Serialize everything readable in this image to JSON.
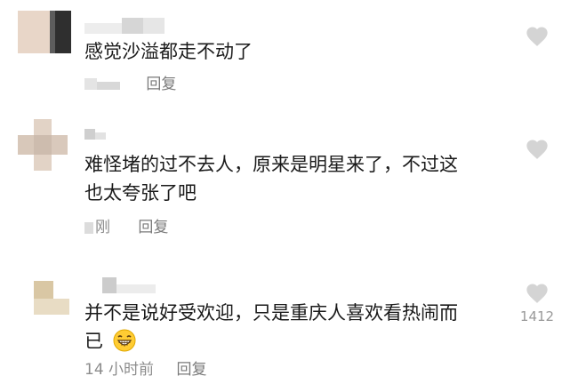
{
  "comments": [
    {
      "text": "感觉沙溢都走不动了",
      "time": "",
      "reply_label": "回复",
      "like_count": ""
    },
    {
      "text": "难怪堵的过不去人，原来是明星来了，不过这\n也太夸张了吧",
      "time": "刚",
      "reply_label": "回复",
      "like_count": ""
    },
    {
      "text": "并不是说好受欢迎，只是重庆人喜欢看热闹而\n已",
      "time": "14 小时前",
      "reply_label": "回复",
      "like_count": "1412"
    }
  ],
  "icons": {
    "like": "heart-icon",
    "emoji": "grinning-face-emoji"
  },
  "colors": {
    "text": "#1a1a1a",
    "meta": "#8c8c8c",
    "heart": "#d4d4d4"
  }
}
